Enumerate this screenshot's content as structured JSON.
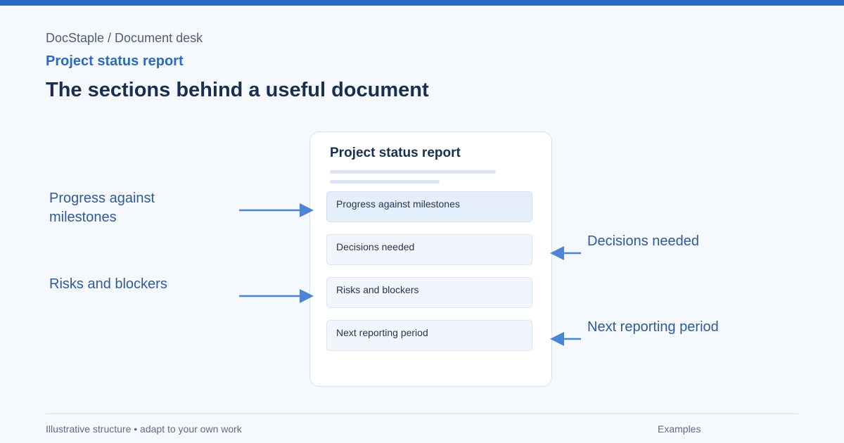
{
  "header": {
    "breadcrumb": "DocStaple / Document desk",
    "kicker": "Project status report",
    "headline": "The sections behind a useful document"
  },
  "document": {
    "title": "Project status report",
    "sections": [
      "Progress against milestones",
      "Decisions needed",
      "Risks and blockers",
      "Next reporting period"
    ]
  },
  "callouts": {
    "left": [
      "Progress against milestones",
      "Risks and blockers"
    ],
    "right": [
      "Decisions needed",
      "Next reporting period"
    ]
  },
  "footer": {
    "note": "Illustrative structure • adapt to your own work",
    "link": "Examples"
  },
  "colors": {
    "accent": "#2a6ac2",
    "arrow": "#4a86d4",
    "heading": "#17304f",
    "callout_text": "#2d5c98"
  }
}
